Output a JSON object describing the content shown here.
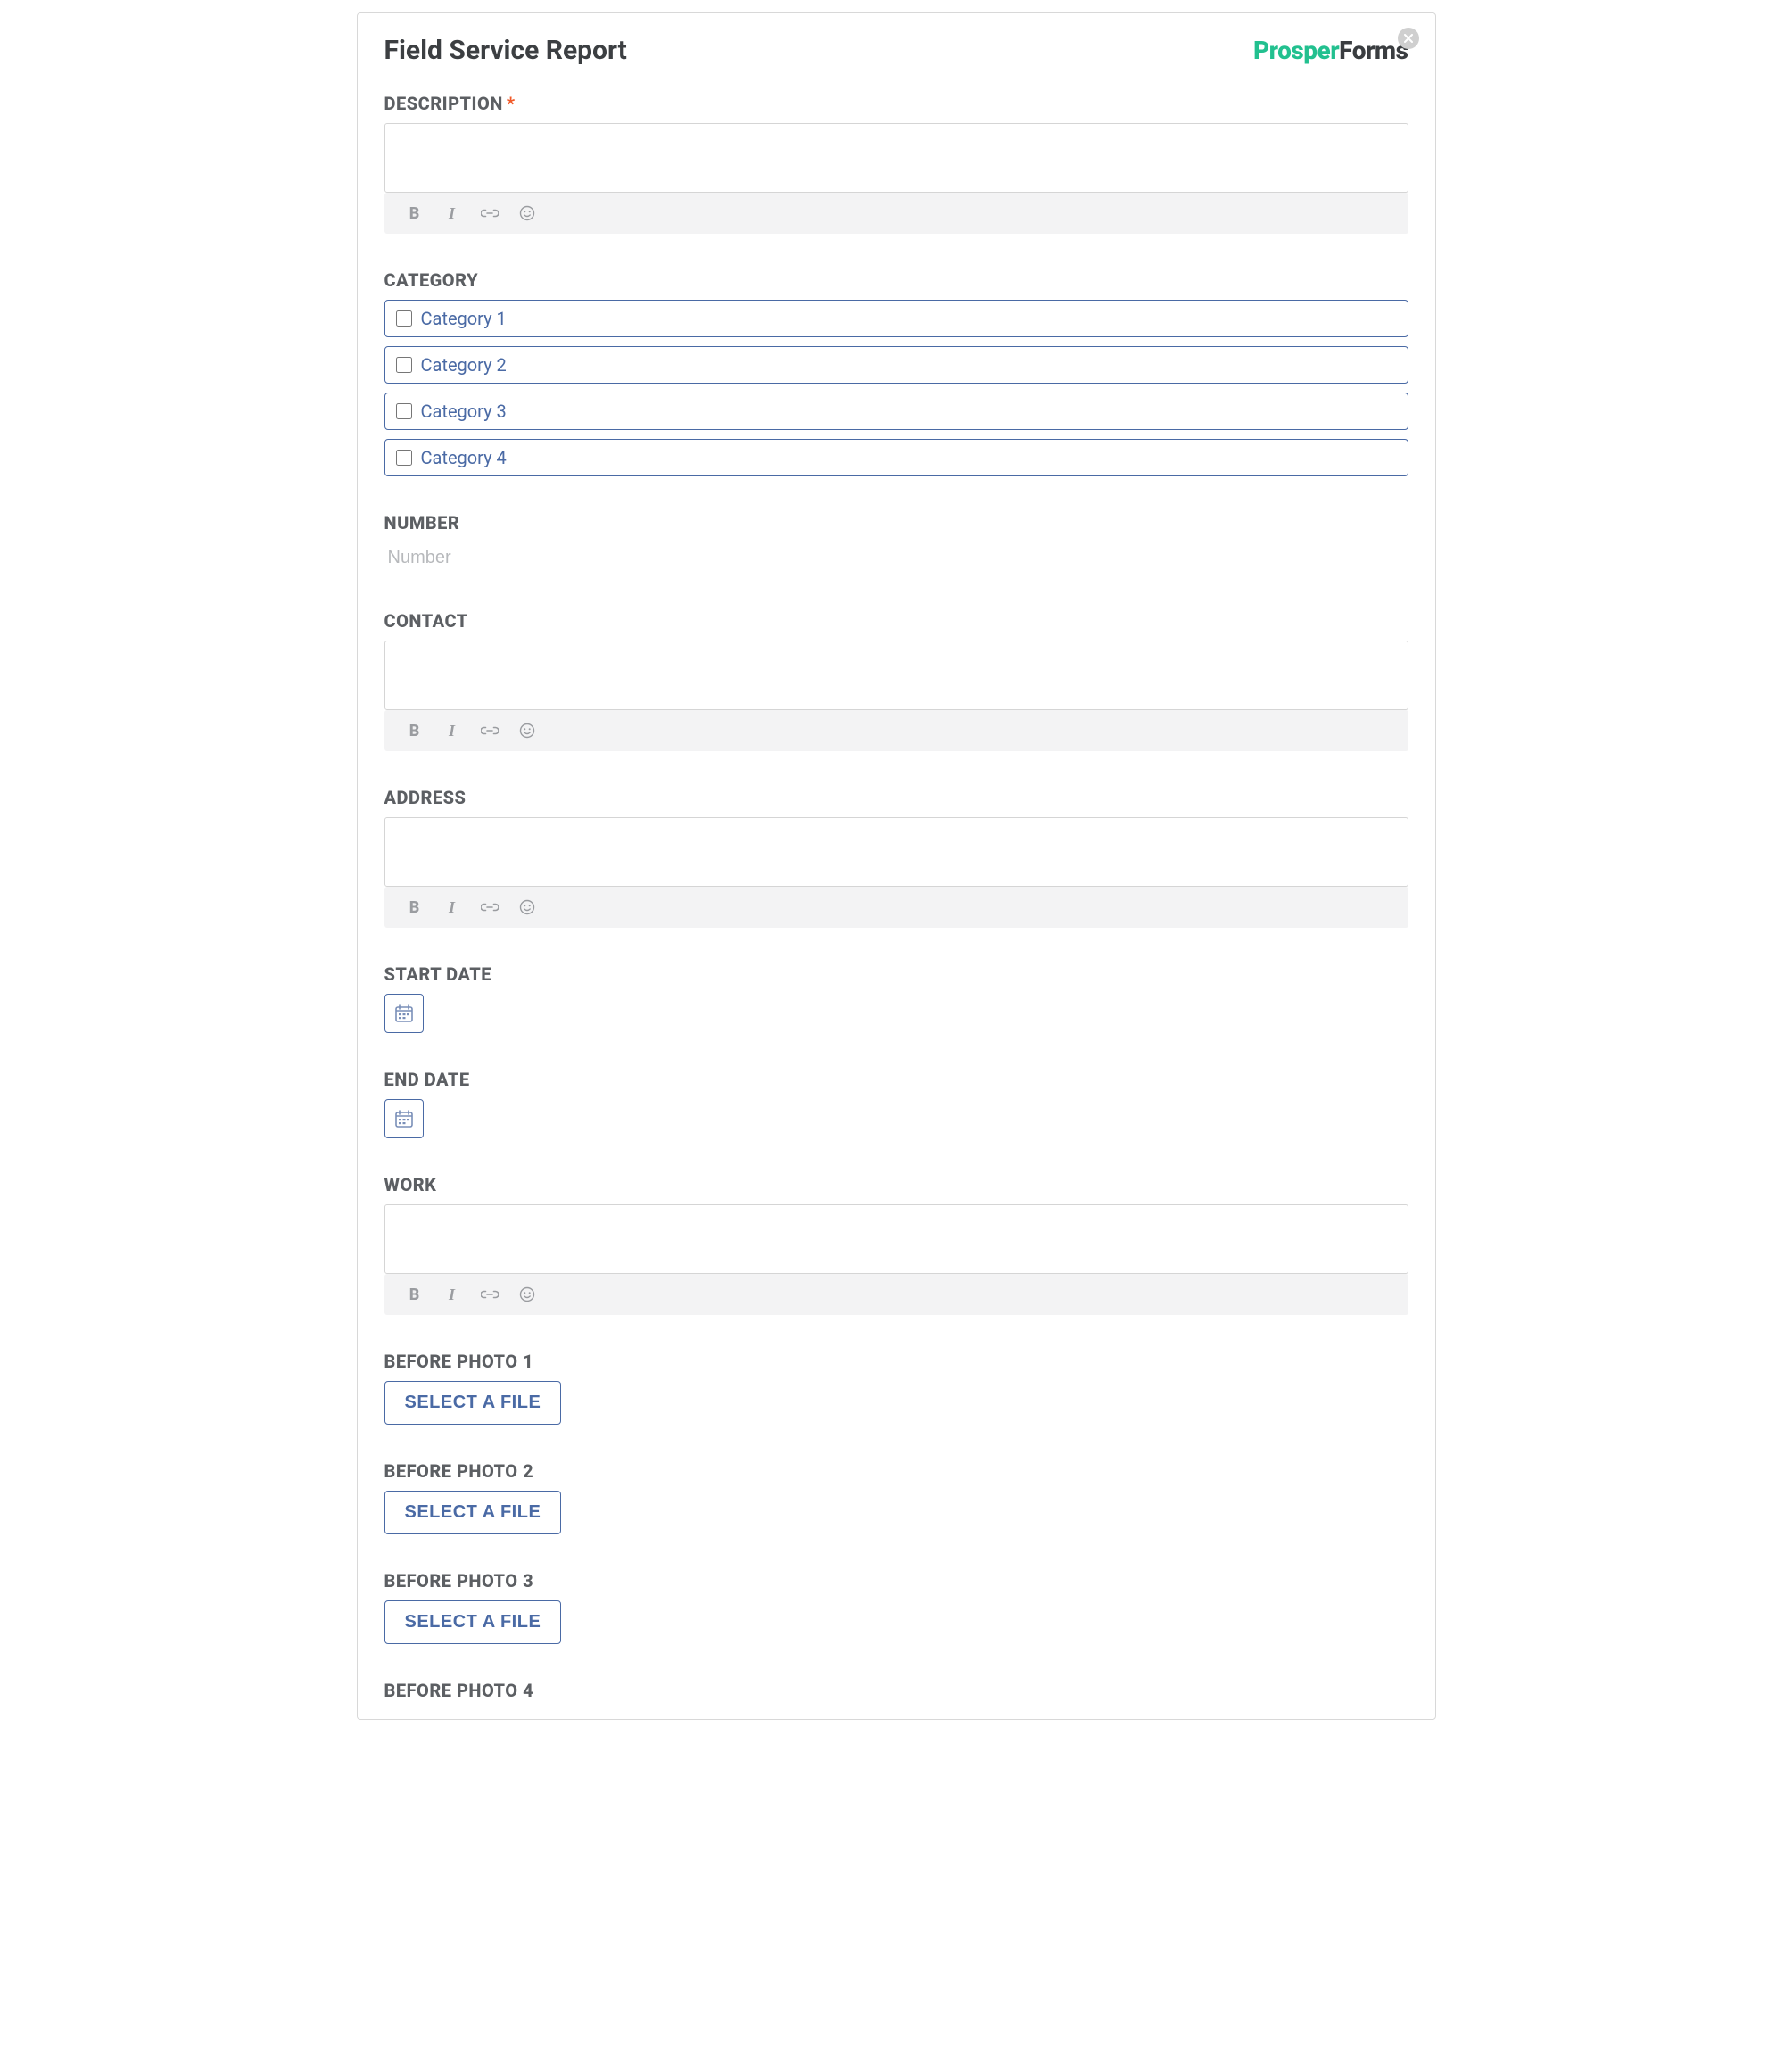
{
  "header": {
    "title": "Field Service Report",
    "brand_a": "Prosper",
    "brand_b": "Forms"
  },
  "labels": {
    "description": "DESCRIPTION",
    "category": "CATEGORY",
    "number": "NUMBER",
    "contact": "CONTACT",
    "address": "ADDRESS",
    "start_date": "START DATE",
    "end_date": "END DATE",
    "work": "WORK",
    "before_photo_1": "BEFORE PHOTO 1",
    "before_photo_2": "BEFORE PHOTO 2",
    "before_photo_3": "BEFORE PHOTO 3",
    "before_photo_4": "BEFORE PHOTO 4"
  },
  "required_mark": "*",
  "categories": [
    {
      "label": "Category 1"
    },
    {
      "label": "Category 2"
    },
    {
      "label": "Category 3"
    },
    {
      "label": "Category 4"
    }
  ],
  "number": {
    "placeholder": "Number"
  },
  "file_button_label": "SELECT A FILE",
  "toolbar": {
    "bold": "B",
    "italic": "I"
  }
}
